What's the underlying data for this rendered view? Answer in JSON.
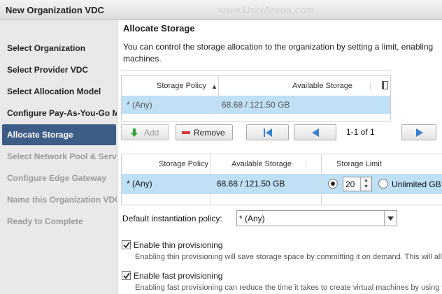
{
  "window": {
    "title": "New Organization VDC",
    "watermark": "www.UnixArena.com"
  },
  "sidebar": {
    "steps": [
      {
        "label": "Select Organization",
        "state": "done"
      },
      {
        "label": "Select Provider VDC",
        "state": "done"
      },
      {
        "label": "Select Allocation Model",
        "state": "done"
      },
      {
        "label": "Configure Pay-As-You-Go Mo",
        "state": "done"
      },
      {
        "label": "Allocate Storage",
        "state": "active"
      },
      {
        "label": "Select Network Pool & Servi",
        "state": "disabled"
      },
      {
        "label": "Configure Edge Gateway",
        "state": "disabled"
      },
      {
        "label": "Name this Organization VDC",
        "state": "disabled"
      },
      {
        "label": "Ready to Complete",
        "state": "disabled"
      }
    ]
  },
  "main": {
    "heading": "Allocate Storage",
    "description": "You can control the storage allocation to the organization by setting a limit, enabling machines."
  },
  "available_grid": {
    "headers": [
      "Storage Policy",
      "Available Storage"
    ],
    "sort_indicator": "▲",
    "rows": [
      {
        "policy": "* (Any)",
        "available": "68.68 / 121.50 GB"
      }
    ]
  },
  "toolbar": {
    "add_label": "Add",
    "remove_label": "Remove",
    "pager_text": "1-1 of 1"
  },
  "selected_grid": {
    "headers": [
      "Storage Policy",
      "Available Storage",
      "Storage Limit"
    ],
    "rows": [
      {
        "policy": "* (Any)",
        "available": "68.68 / 121.50 GB",
        "limit_value": "20",
        "unlimited_label": "Unlimited GB"
      }
    ]
  },
  "default_policy": {
    "label": "Default instantiation policy:",
    "value": "* (Any)"
  },
  "thin_provisioning": {
    "checked": true,
    "label": "Enable thin provisioning",
    "help": "Enabling thin provisioning will save storage space by committing it on demand. This will allow"
  },
  "fast_provisioning": {
    "checked": true,
    "label": "Enable fast provisioning",
    "help": "Enabling fast provisioning can reduce the time it takes to create virtual machines by using v"
  },
  "colors": {
    "active_step": "#3e5d86",
    "selected_row": "#bfe0f5",
    "pager_arrow": "#3a7fd0",
    "add_icon": "#2fa33a",
    "remove_icon": "#d03a3a"
  }
}
